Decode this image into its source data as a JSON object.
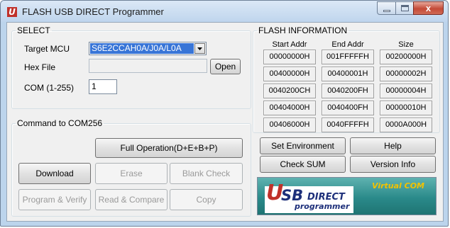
{
  "window": {
    "title": "FLASH USB DIRECT Programmer",
    "logo_letter": "U",
    "close_glyph": "x"
  },
  "select": {
    "legend": "SELECT",
    "target_mcu_label": "Target MCU",
    "target_mcu_value": "S6E2CCAH0A/J0A/L0A",
    "hex_file_label": "Hex File",
    "hex_file_value": "",
    "open_label": "Open",
    "com_label": "COM (1-255)",
    "com_value": "1"
  },
  "command": {
    "legend": "Command  to  COM256",
    "full_operation": "Full Operation(D+E+B+P)",
    "download": "Download",
    "erase": "Erase",
    "blank_check": "Blank Check",
    "program_verify": "Program & Verify",
    "read_compare": "Read & Compare",
    "copy": "Copy"
  },
  "flash_info": {
    "legend": "FLASH INFORMATION",
    "columns": [
      "Start Addr",
      "End Addr",
      "Size"
    ],
    "rows": [
      [
        "00000000H",
        "001FFFFFH",
        "00200000H"
      ],
      [
        "00400000H",
        "00400001H",
        "00000002H"
      ],
      [
        "0040200CH",
        "0040200FH",
        "00000004H"
      ],
      [
        "00404000H",
        "0040400FH",
        "00000010H"
      ],
      [
        "00406000H",
        "0040FFFFH",
        "0000A000H"
      ]
    ]
  },
  "actions": {
    "set_environment": "Set Environment",
    "help": "Help",
    "check_sum": "Check SUM",
    "version_info": "Version Info"
  },
  "banner": {
    "logo_u": "U",
    "logo_sb": "SB",
    "direct": "DIRECT",
    "programmer": "programmer",
    "virtual_com": "Virtual COM",
    "bg_color": "#2a8a8a",
    "accent_color": "#f2c200"
  },
  "icons": {
    "dropdown": "chevron-down-icon",
    "minimize": "minimize-icon",
    "maximize": "maximize-icon",
    "close": "close-icon"
  }
}
